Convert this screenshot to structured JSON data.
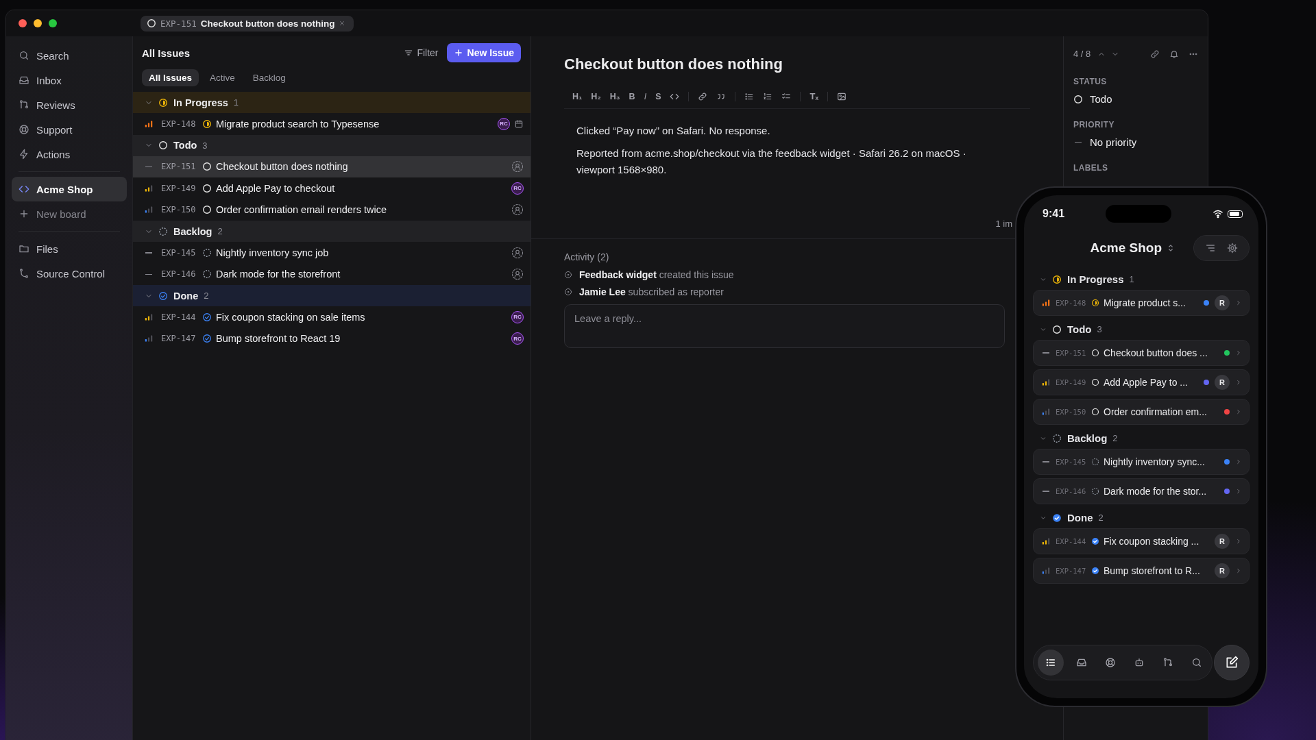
{
  "tab": {
    "id": "EXP-151",
    "title": "Checkout button does nothing"
  },
  "sidebar": {
    "nav": [
      {
        "label": "Search",
        "selected": false
      },
      {
        "label": "Inbox",
        "selected": false
      },
      {
        "label": "Reviews",
        "selected": false
      },
      {
        "label": "Support",
        "selected": false
      },
      {
        "label": "Actions",
        "selected": false
      }
    ],
    "boards": [
      {
        "label": "Acme Shop",
        "selected": true
      }
    ],
    "new_board": "New board",
    "places": [
      {
        "label": "Files",
        "selected": false
      },
      {
        "label": "Source Control",
        "selected": false
      }
    ]
  },
  "list": {
    "title": "All Issues",
    "filter": "Filter",
    "new_issue": "New Issue",
    "views": [
      {
        "label": "All Issues",
        "selected": true
      },
      {
        "label": "Active",
        "selected": false
      },
      {
        "label": "Backlog",
        "selected": false
      }
    ],
    "groups": [
      {
        "kind": "in_progress",
        "name": "In Progress",
        "count": "1",
        "expanded": true,
        "issues": [
          {
            "id": "EXP-148",
            "title": "Migrate product search to Typesense",
            "kind": "high",
            "assignee": "RC",
            "has_due_date": true,
            "selected": false
          }
        ]
      },
      {
        "kind": "todo",
        "name": "Todo",
        "count": "3",
        "expanded": true,
        "issues": [
          {
            "id": "EXP-151",
            "title": "Checkout button does nothing",
            "kind": "none",
            "has_due_date": false,
            "selected": true
          },
          {
            "id": "EXP-149",
            "title": "Add Apple Pay to checkout",
            "kind": "medium",
            "assignee": "RC",
            "has_due_date": false,
            "selected": false
          },
          {
            "id": "EXP-150",
            "title": "Order confirmation email renders twice",
            "kind": "low",
            "has_due_date": false,
            "selected": false
          }
        ]
      },
      {
        "kind": "backlog",
        "name": "Backlog",
        "count": "2",
        "expanded": true,
        "issues": [
          {
            "id": "EXP-145",
            "title": "Nightly inventory sync job",
            "kind": "none",
            "has_due_date": false,
            "selected": false
          },
          {
            "id": "EXP-146",
            "title": "Dark mode for the storefront",
            "kind": "none",
            "has_due_date": false,
            "selected": false
          }
        ]
      },
      {
        "kind": "done",
        "name": "Done",
        "count": "2",
        "expanded": true,
        "issues": [
          {
            "id": "EXP-144",
            "title": "Fix coupon stacking on sale items",
            "kind": "medium",
            "assignee": "RC",
            "has_due_date": false,
            "selected": false
          },
          {
            "id": "EXP-147",
            "title": "Bump storefront to React 19",
            "kind": "low",
            "assignee": "RC",
            "has_due_date": false,
            "selected": false
          }
        ]
      }
    ]
  },
  "editor": {
    "title": "Checkout button does nothing",
    "toolbar": [
      {
        "kind": "heading",
        "label": "H₁"
      },
      {
        "kind": "heading",
        "label": "H₂"
      },
      {
        "kind": "heading",
        "label": "H₃"
      },
      {
        "kind": "bold",
        "label": "B"
      },
      {
        "kind": "italic",
        "label": "I"
      },
      {
        "kind": "strike",
        "label": "S"
      }
    ],
    "clear_format": "Tₓ",
    "body": [
      "Clicked “Pay now” on Safari. No response.",
      "Reported from acme.shop/checkout via the feedback widget · Safari 26.2 on macOS · viewport 1568×980."
    ],
    "attachments": "1 im",
    "activity_title": "Activity (2)",
    "activity": [
      "**Feedback widget** created this issue",
      "**Jamie Lee** subscribed as reporter"
    ],
    "reply_placeholder": "Leave a reply..."
  },
  "details": {
    "position": "4 / 8",
    "fields": [
      {
        "kind": "status",
        "label": "STATUS",
        "value": "Todo"
      },
      {
        "kind": "priority",
        "label": "PRIORITY",
        "value": "No priority"
      }
    ],
    "labels_heading": "LABELS"
  },
  "phone": {
    "time": "9:41",
    "title": "Acme Shop",
    "groups": [
      {
        "kind": "in_progress",
        "name": "In Progress",
        "count": "1",
        "expanded": true,
        "issues": [
          {
            "id": "EXP-148",
            "title": "Migrate product s...",
            "kind": "high",
            "color": "#3b82f6",
            "assignee": "R"
          }
        ]
      },
      {
        "kind": "todo",
        "name": "Todo",
        "count": "3",
        "expanded": true,
        "issues": [
          {
            "id": "EXP-151",
            "title": "Checkout button does ...",
            "kind": "none",
            "color": "#22c55e"
          },
          {
            "id": "EXP-149",
            "title": "Add Apple Pay to ...",
            "kind": "medium",
            "color": "#6366f1",
            "assignee": "R"
          },
          {
            "id": "EXP-150",
            "title": "Order confirmation em...",
            "kind": "low",
            "color": "#ef4444"
          }
        ]
      },
      {
        "kind": "backlog",
        "name": "Backlog",
        "count": "2",
        "expanded": true,
        "issues": [
          {
            "id": "EXP-145",
            "title": "Nightly inventory sync...",
            "kind": "none",
            "color": "#3b82f6"
          },
          {
            "id": "EXP-146",
            "title": "Dark mode for the stor...",
            "kind": "none",
            "color": "#6366f1"
          }
        ]
      },
      {
        "kind": "done",
        "name": "Done",
        "count": "2",
        "expanded": true,
        "issues": [
          {
            "id": "EXP-144",
            "title": "Fix coupon stacking ...",
            "kind": "medium",
            "assignee": "R"
          },
          {
            "id": "EXP-147",
            "title": "Bump storefront to R...",
            "kind": "low",
            "assignee": "R"
          }
        ]
      }
    ],
    "tab_bar": [
      {
        "selected": true
      },
      {
        "selected": false
      },
      {
        "selected": false
      },
      {
        "selected": false
      },
      {
        "selected": false
      },
      {
        "selected": false
      }
    ]
  }
}
